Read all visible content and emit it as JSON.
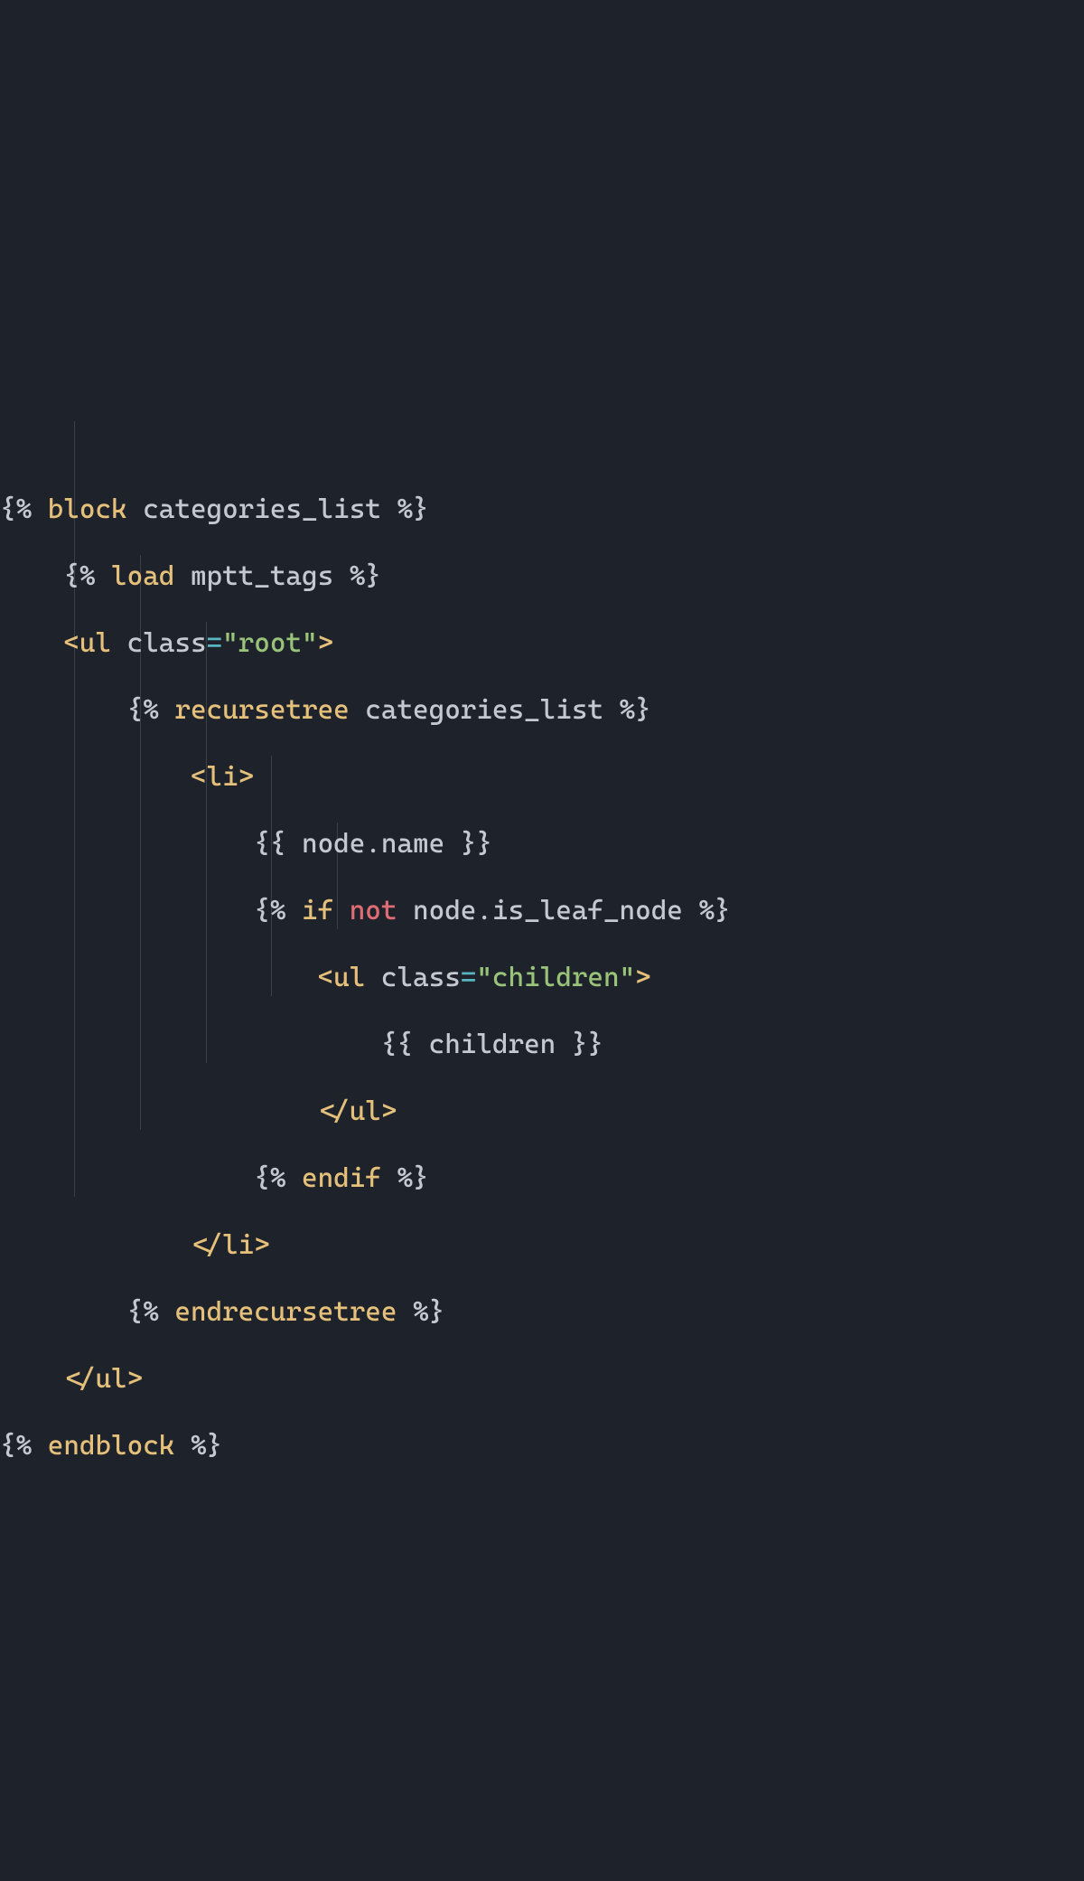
{
  "colors": {
    "background": "#1e222a",
    "default": "#c4c8d0",
    "keyword": "#e5c07b",
    "tag": "#e5c07b",
    "operator": "#56b6c2",
    "string": "#98c379",
    "not": "#e06c75",
    "guide": "#3a3f4a"
  },
  "code": {
    "lines": [
      {
        "indent": 0,
        "tokens": [
          {
            "t": "{% ",
            "c": "delim"
          },
          {
            "t": "block",
            "c": "keyword"
          },
          {
            "t": " categories_list ",
            "c": "default"
          },
          {
            "t": "%}",
            "c": "delim"
          }
        ]
      },
      {
        "indent": 1,
        "tokens": [
          {
            "t": "{% ",
            "c": "delim"
          },
          {
            "t": "load",
            "c": "keyword"
          },
          {
            "t": " mptt_tags ",
            "c": "default"
          },
          {
            "t": "%}",
            "c": "delim"
          }
        ]
      },
      {
        "indent": 1,
        "tokens": [
          {
            "t": "<",
            "c": "tag"
          },
          {
            "t": "ul",
            "c": "tag"
          },
          {
            "t": " ",
            "c": "default"
          },
          {
            "t": "class",
            "c": "attr"
          },
          {
            "t": "=",
            "c": "op"
          },
          {
            "t": "\"root\"",
            "c": "string"
          },
          {
            "t": ">",
            "c": "tag"
          }
        ]
      },
      {
        "indent": 2,
        "tokens": [
          {
            "t": "{% ",
            "c": "delim"
          },
          {
            "t": "recursetree",
            "c": "keyword"
          },
          {
            "t": " categories_list ",
            "c": "default"
          },
          {
            "t": "%}",
            "c": "delim"
          }
        ]
      },
      {
        "indent": 3,
        "tokens": [
          {
            "t": "<",
            "c": "tag"
          },
          {
            "t": "li",
            "c": "tag"
          },
          {
            "t": ">",
            "c": "tag"
          }
        ]
      },
      {
        "indent": 4,
        "tokens": [
          {
            "t": "{{ node.name }}",
            "c": "default"
          }
        ]
      },
      {
        "indent": 4,
        "tokens": [
          {
            "t": "{% ",
            "c": "delim"
          },
          {
            "t": "if",
            "c": "keyword"
          },
          {
            "t": " ",
            "c": "default"
          },
          {
            "t": "not",
            "c": "not"
          },
          {
            "t": " node.is_leaf_node ",
            "c": "default"
          },
          {
            "t": "%}",
            "c": "delim"
          }
        ]
      },
      {
        "indent": 5,
        "tokens": [
          {
            "t": "<",
            "c": "tag"
          },
          {
            "t": "ul",
            "c": "tag"
          },
          {
            "t": " ",
            "c": "default"
          },
          {
            "t": "class",
            "c": "attr"
          },
          {
            "t": "=",
            "c": "op"
          },
          {
            "t": "\"children\"",
            "c": "string"
          },
          {
            "t": ">",
            "c": "tag"
          }
        ]
      },
      {
        "indent": 6,
        "tokens": [
          {
            "t": "{{ children }}",
            "c": "default"
          }
        ]
      },
      {
        "indent": 5,
        "tokens": [
          {
            "t": "</",
            "c": "tag"
          },
          {
            "t": "ul",
            "c": "tag"
          },
          {
            "t": ">",
            "c": "tag"
          }
        ]
      },
      {
        "indent": 4,
        "tokens": [
          {
            "t": "{% ",
            "c": "delim"
          },
          {
            "t": "endif",
            "c": "keyword"
          },
          {
            "t": " ",
            "c": "default"
          },
          {
            "t": "%}",
            "c": "delim"
          }
        ]
      },
      {
        "indent": 3,
        "tokens": [
          {
            "t": "</",
            "c": "tag"
          },
          {
            "t": "li",
            "c": "tag"
          },
          {
            "t": ">",
            "c": "tag"
          }
        ]
      },
      {
        "indent": 2,
        "tokens": [
          {
            "t": "{% ",
            "c": "delim"
          },
          {
            "t": "endrecursetree",
            "c": "keyword"
          },
          {
            "t": " ",
            "c": "default"
          },
          {
            "t": "%}",
            "c": "delim"
          }
        ]
      },
      {
        "indent": 1,
        "tokens": [
          {
            "t": "</",
            "c": "tag"
          },
          {
            "t": "ul",
            "c": "tag"
          },
          {
            "t": ">",
            "c": "tag"
          }
        ]
      },
      {
        "indent": 0,
        "tokens": [
          {
            "t": "{% ",
            "c": "delim"
          },
          {
            "t": "endblock",
            "c": "keyword"
          },
          {
            "t": " ",
            "c": "default"
          },
          {
            "t": "%}",
            "c": "delim"
          }
        ]
      }
    ]
  },
  "guides": [
    {
      "col": 1,
      "startLine": 2,
      "endLine": 13
    },
    {
      "col": 2,
      "startLine": 4,
      "endLine": 12
    },
    {
      "col": 3,
      "startLine": 5,
      "endLine": 11
    },
    {
      "col": 4,
      "startLine": 7,
      "endLine": 10
    },
    {
      "col": 5,
      "startLine": 8,
      "endLine": 9
    }
  ],
  "indentWidth": 4,
  "charWidth": 18.2,
  "lineHeight": 74,
  "leftPad": 2
}
